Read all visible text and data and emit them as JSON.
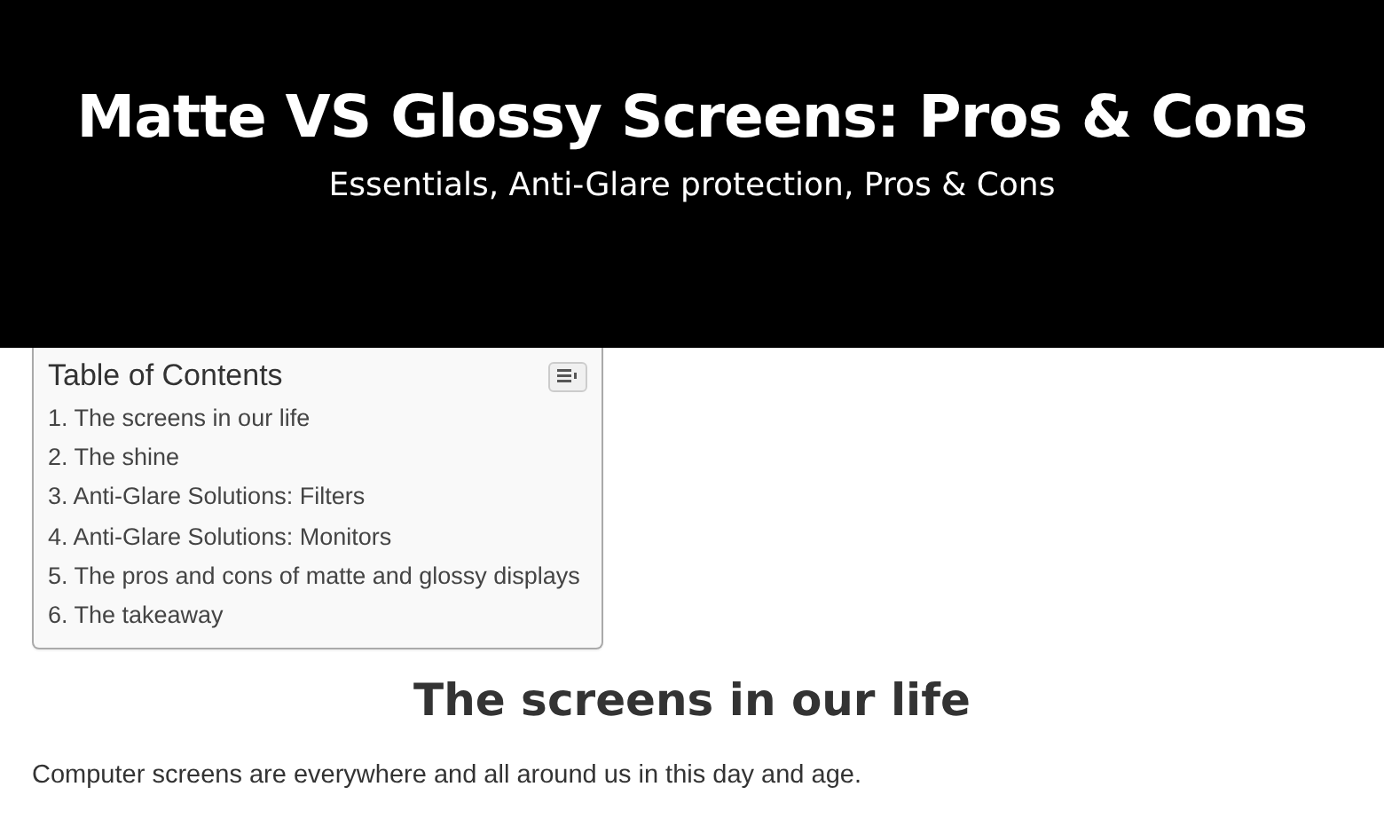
{
  "banner": {
    "title": "Matte VS Glossy Screens: Pros & Cons",
    "subtitle": "Essentials, Anti-Glare protection, Pros & Cons"
  },
  "toc": {
    "title": "Table of Contents",
    "items": [
      {
        "label": "1. The screens in our life"
      },
      {
        "label": "2. The shine"
      },
      {
        "label": "3. Anti-Glare Solutions: Filters"
      },
      {
        "label": "4. Anti-Glare Solutions: Monitors"
      },
      {
        "label": "5. The pros and cons of matte and glossy displays"
      },
      {
        "label": "6. The takeaway"
      }
    ]
  },
  "section": {
    "heading": "The screens in our life",
    "paragraph": "Computer screens are everywhere and all around us in this day and age."
  }
}
